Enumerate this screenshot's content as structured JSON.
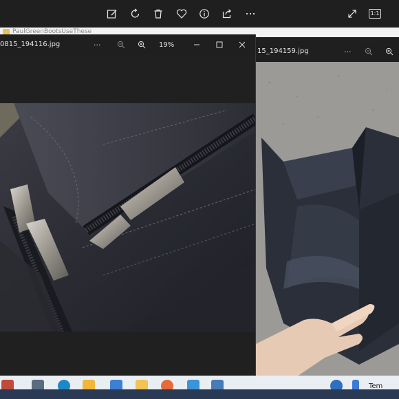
{
  "toolbar": {
    "icons": [
      "edit-image-icon",
      "rotate-icon",
      "delete-icon",
      "heart-icon",
      "info-icon",
      "share-icon",
      "more-icon",
      "fullscreen-icon",
      "actual-size-icon"
    ],
    "actual_size_label": "1:1"
  },
  "explorer": {
    "breadcrumb": "PaulGreenBootsUseThese"
  },
  "left_window": {
    "filename": "0815_194116.jpg",
    "zoom": "19%",
    "more_label": "···"
  },
  "right_window": {
    "filename": "15_194159.jpg",
    "more_label": "···"
  },
  "taskbar": {
    "weather_label": "Tem"
  },
  "colors": {
    "leather": "#2e2f38",
    "taskbar": "#e9eef3",
    "toolbar": "#1f1f1f"
  }
}
